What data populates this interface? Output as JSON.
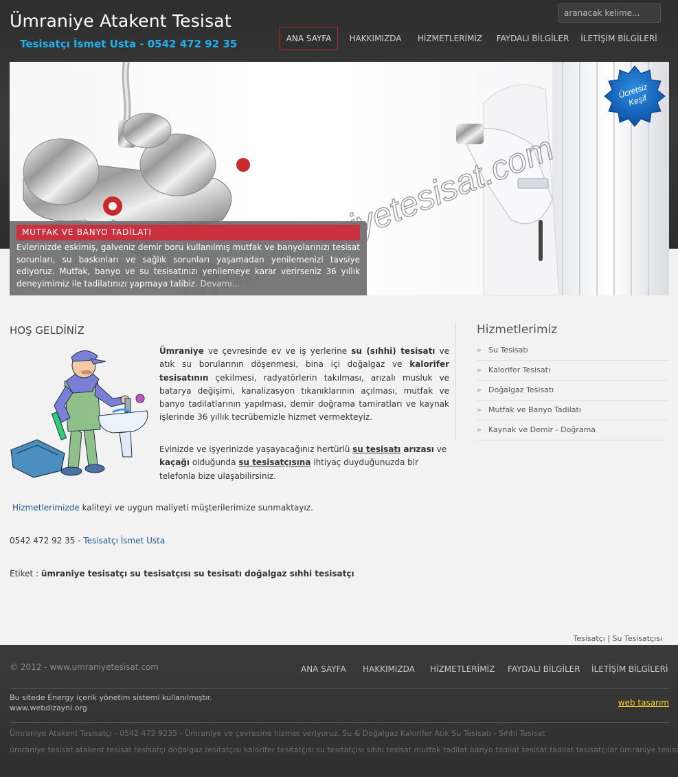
{
  "header": {
    "title": "Ümraniye Atakent Tesisat",
    "subtitle": "Tesisatçı İsmet Usta - 0542 472 92 35",
    "search_placeholder": "aranacak kelime..."
  },
  "nav": [
    {
      "label": "ANA SAYFA",
      "active": true
    },
    {
      "label": "HAKKIMIZDA"
    },
    {
      "label": "HİZMETLERİMİZ"
    },
    {
      "label": "FAYDALI BİLGİLER"
    },
    {
      "label": "İLETİŞİM BİLGİLERİ"
    }
  ],
  "slider": {
    "watermark": "www.umraniyetesisat.com",
    "badge_line1": "Ücretsiz",
    "badge_line2": "Keşif",
    "caption_title": "MUTFAK VE BANYO TADİLATI",
    "caption_text": "Evlerinizde eskimiş, galveniz demir boru kullanılmış mutfak ve banyolarınızı tesisat sorunları, su baskınları ve sağlık sorunları yaşamadan yenilemenizi tavsiye ediyoruz. Mutfak, banyo ve su tesisatınızı yenilemeye karar verirseniz 36 yıllık deneyimimiz ile tadilatınızı yapmaya talibiz.",
    "caption_more": "Devamı..."
  },
  "main": {
    "welcome_title": "HOŞ GELDİNİZ",
    "intro": {
      "p1_b1": "Ümraniye",
      "p1_t1": " ve çevresinde ev ve iş yerlerine ",
      "p1_b2": "su (sıhhi) tesisatı",
      "p1_t2": " ve atık su borularının döşenmesi, bina içi doğalgaz ve ",
      "p1_b3": "kalorifer tesisatının",
      "p1_t3": " çekilmesi, radyatörlerin takılması, arızalı musluk ve batarya değişimi, kanalizasyon tıkanıklarının açılması, mutfak ve banyo tadilatlarının yapılması, demir doğrama tamiratları ve kaynak işlerinde 36 yıllık tecrübemizle hizmet vermekteyiz.",
      "p2_t1": "Evinizde ve işyerinizde yaşayacağınız hertürlü ",
      "p2_u1": "su tesisatı",
      "p2_b1": " arızası",
      "p2_t2": " ve ",
      "p2_b2": "kaçağı",
      "p2_t3": " olduğunda  ",
      "p2_u2": "su tesisatçısına",
      "p2_t4": " ihtiyaç duyduğunuzda bir telefonla bize ulaşabilirsiniz."
    },
    "quality_link": "Hizmetlerimizde",
    "quality_text": " kaliteyi ve uygun maliyeti müşterilerimize sunmaktayız.",
    "phone": "0542 472 92 35",
    "phone_sep": " - ",
    "phone_link": "Tesisatçı İsmet Usta",
    "tags_label": "Etiket : ",
    "tags": "ümraniye tesisatçı  su tesisatçısı su tesisatı doğalgaz sıhhi tesisatçı"
  },
  "sidebar": {
    "title": "Hizmetlerimiz",
    "items": [
      {
        "label": "Su Tesisatı"
      },
      {
        "label": "Kalorifer Tesisatı"
      },
      {
        "label": "Doğalgaz Tesisatı"
      },
      {
        "label": "Mutfak ve Banyo Tadilatı"
      },
      {
        "label": "Kaynak ve Demir - Doğrama"
      }
    ],
    "arrow": "»"
  },
  "bottom_tagline": "Tesisatçı | Su Tesisatçısı",
  "footer": {
    "copyright": "© 2012 - www.umraniyetesisat.com",
    "nav": [
      "ANA SAYFA",
      "HAKKIMIZDA",
      "HİZMETLERİMİZ",
      "FAYDALI BİLGİLER",
      "İLETİŞİM BİLGİLERİ"
    ],
    "cms_line1": "Bu sitede Energy içerik yönetim sistemi kullanılmıştır.",
    "cms_line2": "www.webdizayni.org",
    "web_design": "web tasarım",
    "seo_line1": "Ümraniye Atakent Tesisatçı - 0542 472 9235 - Ümraniye ve çevresine hizmet veriyoruz. Su & Doğalgaz Kalorifer Atık Su Tesisatı - Sıhhi Tesisat",
    "seo_line2": "ümraniye tesisat atakent tesisat tesisatçı doğalgaz tesitatçısı kalorifer tesitatçısı su tesitatçısı sıhhi tesisat mutfak tadilat banyo tadilat tesisat tadilat tesisatçılar ümraniye tesisatçı"
  },
  "colors": {
    "accent_red": "#c8313d",
    "subtitle_blue": "#22b0ee",
    "link_blue": "#225588",
    "footer_link_yellow": "#ffd42a"
  }
}
